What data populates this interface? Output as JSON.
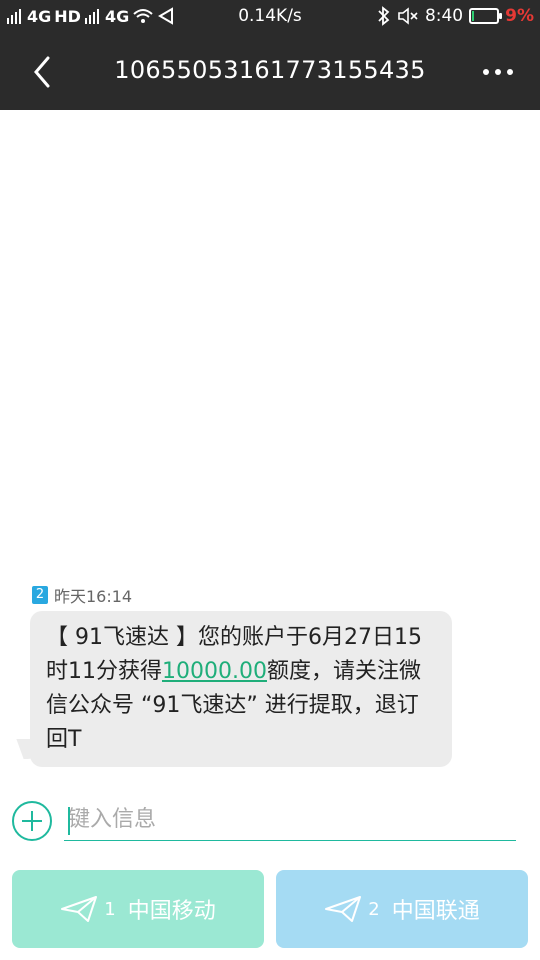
{
  "status_bar": {
    "network_1": "4G",
    "hd": "HD",
    "network_2": "4G",
    "speed": "0.14K/s",
    "time": "8:40",
    "battery_percent": "9%",
    "battery_level": 0.09
  },
  "header": {
    "title": "10655053161773155435"
  },
  "message": {
    "sim": "2",
    "timestamp": "昨天16:14",
    "text_before": "【 91飞速达 】您的账户于6月27日15时11分获得",
    "link_text": "10000.00",
    "text_after": "额度，请关注微信公众号 “91飞速达” 进行提取，退订回T"
  },
  "compose": {
    "placeholder": "键入信息"
  },
  "send_buttons": [
    {
      "sim": "1",
      "label": "中国移动",
      "color": "#9be8d3"
    },
    {
      "sim": "2",
      "label": "中国联通",
      "color": "#a5dbf3"
    }
  ],
  "colors": {
    "accent": "#1fb99e",
    "toolbar": "#2b2b2b",
    "bubble": "#ececec"
  }
}
